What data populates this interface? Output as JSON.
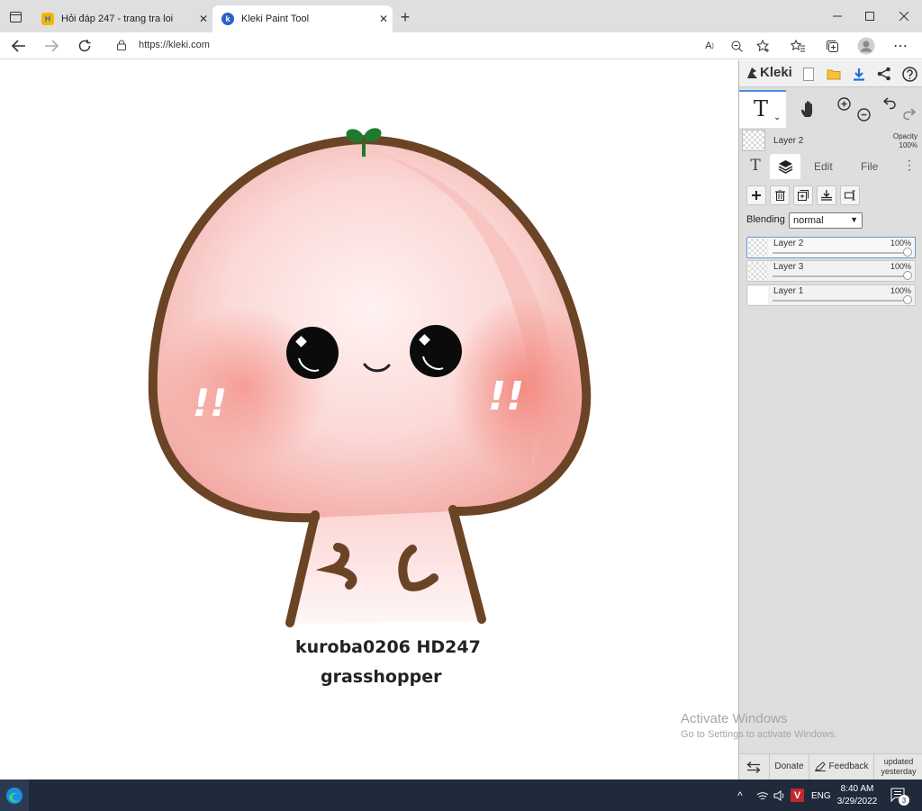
{
  "browser": {
    "tabs": [
      {
        "title": "Hỏi đáp 247 - trang tra loi",
        "active": false
      },
      {
        "title": "Kleki Paint Tool",
        "active": true
      }
    ],
    "url": "https://kleki.com",
    "new_tab_label": "+"
  },
  "canvas": {
    "signature_line1": "kuroba0206 HD247",
    "signature_line2": "grasshopper",
    "exclaim_left": "!!",
    "exclaim_right": "!!",
    "watermark_title": "Activate Windows",
    "watermark_sub": "Go to Settings to activate Windows."
  },
  "kleki": {
    "logo": "Kleki",
    "current_tool_icon": "T",
    "current_layer_name": "Layer 2",
    "opacity_label": "Opacity",
    "opacity_value": "100%",
    "tabs": {
      "text_icon": "T",
      "edit": "Edit",
      "file": "File"
    },
    "blending_label": "Blending",
    "blending_value": "normal",
    "layers": [
      {
        "name": "Layer 2",
        "opacity": "100%",
        "active": true
      },
      {
        "name": "Layer 3",
        "opacity": "100%",
        "active": false
      },
      {
        "name": "Layer 1",
        "opacity": "100%",
        "active": false
      }
    ],
    "footer": {
      "donate": "Donate",
      "feedback": "Feedback",
      "updated_line1": "updated",
      "updated_line2": "yesterday"
    }
  },
  "taskbar": {
    "language": "ENG",
    "time": "8:40 AM",
    "date": "3/29/2022",
    "notification_count": "3"
  },
  "colors": {
    "outline": "#6b4426",
    "peach": "#f6a7a3",
    "leaf": "#1f7a2e",
    "taskbar": "#1f2a3a",
    "panel": "#dedede",
    "accent_blue": "#1e6fd9"
  }
}
